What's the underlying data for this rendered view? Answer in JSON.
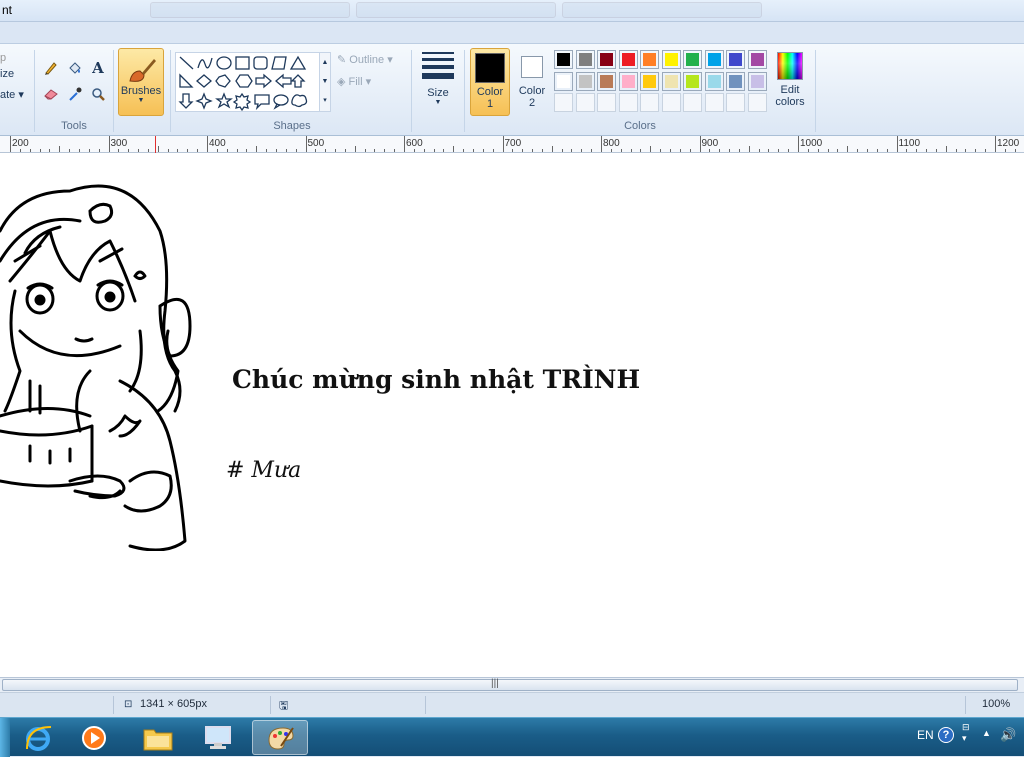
{
  "window": {
    "title_fragment": "nt",
    "blurred_tabs": [
      "",
      "",
      ""
    ]
  },
  "ribbon": {
    "clipboard_fragments": [
      "p",
      "ize",
      "ate ▾"
    ],
    "tools_label": "Tools",
    "brushes_label": "Brushes",
    "shapes_label": "Shapes",
    "outline_label": "Outline",
    "fill_label": "Fill",
    "size_label": "Size",
    "color1_label": "Color 1",
    "color2_label": "Color 2",
    "colors_label": "Colors",
    "edit_colors_label": "Edit colors",
    "color1_value": "#000000",
    "color2_value": "#ffffff",
    "palette_row1": [
      "#000000",
      "#7f7f7f",
      "#880015",
      "#ed1c24",
      "#ff7f27",
      "#fff200",
      "#22b14c",
      "#00a2e8",
      "#3f48cc",
      "#a349a4"
    ],
    "palette_row2": [
      "#ffffff",
      "#c3c3c3",
      "#b97a57",
      "#ffaec9",
      "#ffc90e",
      "#efe4b0",
      "#b5e61d",
      "#99d9ea",
      "#7092be",
      "#c8bfe7"
    ]
  },
  "ruler": {
    "labels": [
      "200",
      "300",
      "400",
      "500",
      "600",
      "700",
      "800",
      "900",
      "1000",
      "1100",
      "1200"
    ]
  },
  "canvas": {
    "main_text": "Chúc mừng sinh nhật TRÌNH",
    "signature": "# Mưa"
  },
  "statusbar": {
    "dimensions": "1341 × 605px",
    "zoom": "100%"
  },
  "taskbar": {
    "language": "EN"
  }
}
